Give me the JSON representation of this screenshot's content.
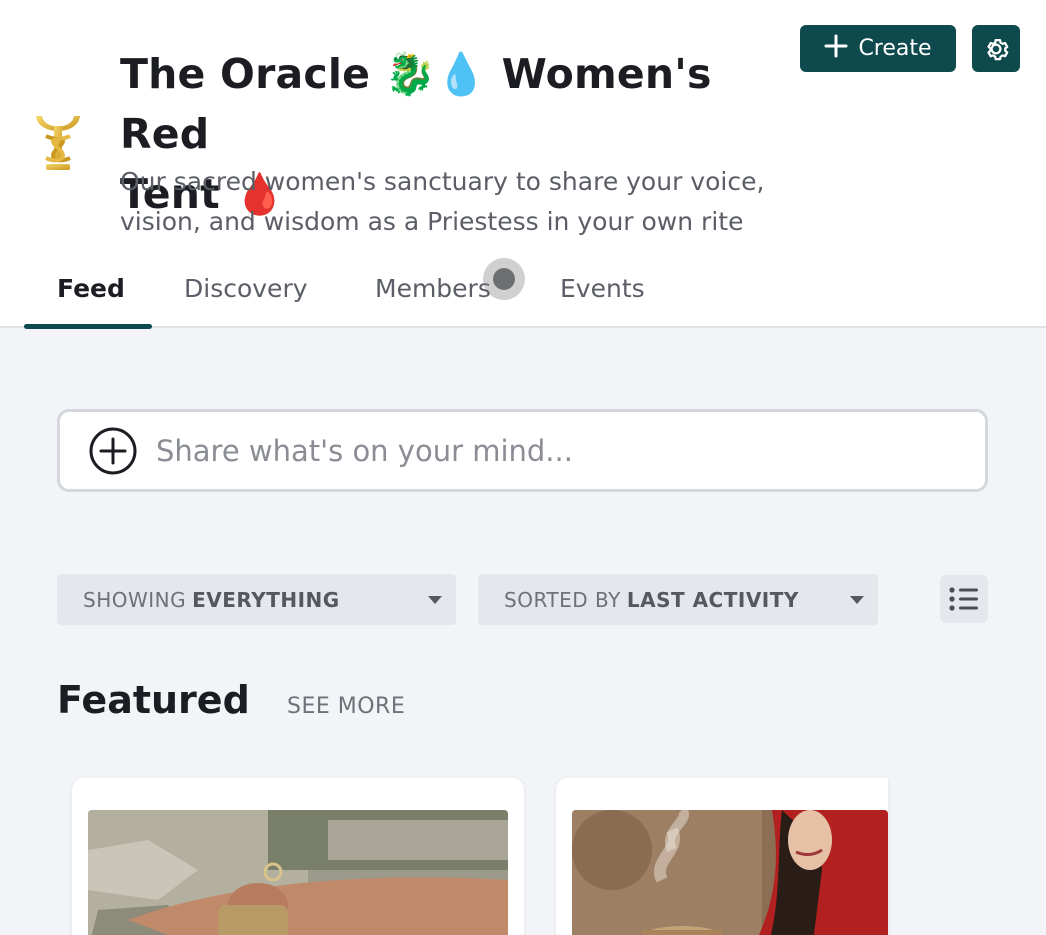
{
  "group": {
    "title": "The Oracle 🐉💧 Women's Red Tent 🩸",
    "title_line1": "The Oracle",
    "title_line1b": "Women's Red",
    "title_line2": "Tent",
    "emoji_dragon": "🐉",
    "emoji_drop": "💧",
    "emoji_blood": "🩸",
    "description": "Our sacred women's sanctuary to share your voice, vision, and wisdom as a Priestess in your own rite"
  },
  "header_actions": {
    "create_label": "Create",
    "create_icon": "plus-icon",
    "settings_icon": "gear-icon"
  },
  "tabs": [
    {
      "label": "Feed",
      "active": true
    },
    {
      "label": "Discovery",
      "active": false
    },
    {
      "label": "Members",
      "active": false
    },
    {
      "label": "Events",
      "active": false
    }
  ],
  "composer": {
    "placeholder": "Share what's on your mind..."
  },
  "filters": {
    "showing_prefix": "SHOWING",
    "showing_value": "EVERYTHING",
    "sorted_prefix": "SORTED BY",
    "sorted_value": "LAST ACTIVITY",
    "layout_icon": "list-view-icon"
  },
  "featured": {
    "title": "Featured",
    "see_more": "SEE MORE"
  },
  "colors": {
    "brand": "#0e4a4d",
    "page_bg": "#f2f4f8",
    "header_bg": "#ffffff",
    "filter_bg": "#e4e7ec"
  }
}
